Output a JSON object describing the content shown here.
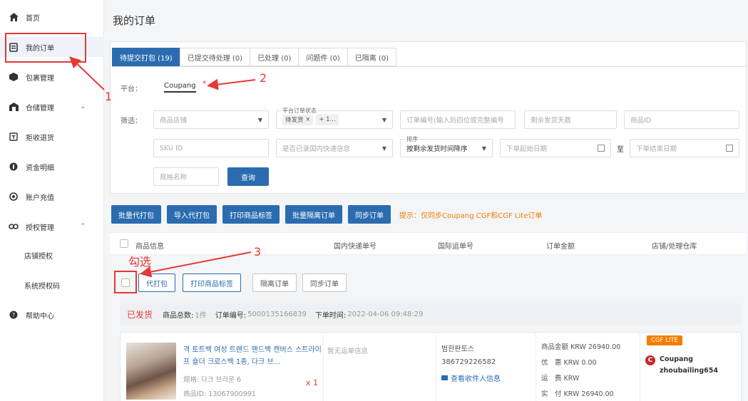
{
  "sidebar": {
    "items": [
      {
        "label": "首页",
        "icon": "home-icon"
      },
      {
        "label": "我的订单",
        "icon": "orders-icon"
      },
      {
        "label": "包裹管理",
        "icon": "package-icon"
      },
      {
        "label": "仓储管理",
        "icon": "warehouse-icon"
      },
      {
        "label": "拒收退货",
        "icon": "return-icon"
      },
      {
        "label": "资金明细",
        "icon": "funds-icon"
      },
      {
        "label": "账户充值",
        "icon": "recharge-icon"
      },
      {
        "label": "授权管理",
        "icon": "authorization-icon"
      },
      {
        "label": "帮助中心",
        "icon": "help-icon"
      }
    ],
    "subitems": [
      "店铺授权",
      "系统授权码"
    ]
  },
  "page": {
    "title": "我的订单"
  },
  "tabs": [
    "待提交打包 (19)",
    "已提交待处理 (0)",
    "已处理 (0)",
    "问题件 (0)",
    "已隔离 (0)"
  ],
  "filters": {
    "platform_label": "平台：",
    "platform_value": "Coupang",
    "required_mark": "*",
    "filter_label": "筛选：",
    "store_placeholder": "商品店铺",
    "status_label": "平台订单状态",
    "status_chip": "待发货",
    "status_more": "+ 1...",
    "order_no_placeholder": "订单编号(输入后四位或完整编号",
    "days_placeholder": "剩余发货天数",
    "product_id_placeholder": "商品ID",
    "sku_placeholder": "SKU ID",
    "domestic_placeholder": "是否已录国内快递信息",
    "sort_label": "排序",
    "sort_value": "按剩余发货时间降序",
    "start_date_placeholder": "下单起始日期",
    "to": "至",
    "end_date_placeholder": "下单结束日期",
    "spec_placeholder": "规格名称",
    "query_button": "查询"
  },
  "actions": {
    "buttons": [
      "批量代打包",
      "导入代打包",
      "打印商品标签",
      "批量隔离订单",
      "同步订单"
    ],
    "hint": "提示：仅同步Coupang CGF和CGF Lite订单"
  },
  "table": {
    "headers": [
      "商品信息",
      "国内快递单号",
      "国际运单号",
      "订单金额",
      "店铺/处理仓库"
    ]
  },
  "row_buttons": [
    "代打包",
    "打印商品标签",
    "隔离订单",
    "同步订单"
  ],
  "order": {
    "status": "已发货",
    "total_label": "商品总数:",
    "total_value": "1件",
    "no_label": "订单编号:",
    "no_value": "5000135166839",
    "time_label": "下单时间:",
    "time_value": "2022-04-06 09:48:29",
    "product_name": "격 토트백 여성 트렌드 핸드백 캔버스 스트라이프 숄더 크로스백 1종, 다크 브...",
    "product_spec": "规格: 다크 브라운 6",
    "product_id": "商品ID: 13067900991",
    "qty": "x 1",
    "no_tracking": "暂无运单信息",
    "carrier": "범한판토스",
    "tracking_no": "386729226582",
    "receiver_link": "查看收件人信息",
    "amounts": [
      "商品金额 KRW 26940.00",
      "优　惠 KRW 0.00",
      "运　费 KRW",
      "实　付 KRW 26940.00"
    ],
    "badge": "CGF LITE",
    "shop_logo": "C",
    "shop_name": "Coupang",
    "shop_user": "zhoubailing654"
  },
  "annotations": {
    "n1": "1",
    "n2": "2",
    "n3": "3",
    "check_text": "勾选"
  }
}
